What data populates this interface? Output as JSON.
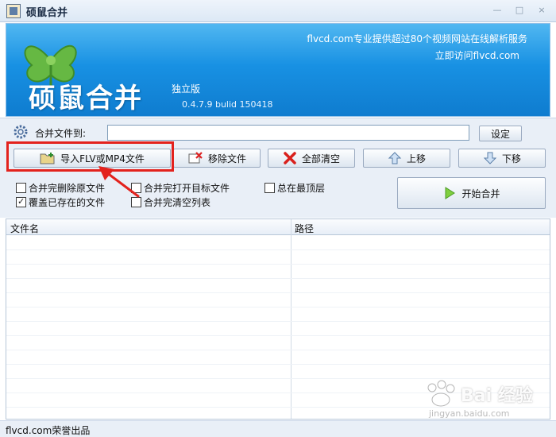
{
  "window": {
    "title": "硕鼠合并",
    "minimize": "—",
    "maximize": "□",
    "close": "×"
  },
  "banner": {
    "info_line1": "flvcd.com专业提供超过80个视频网站在线解析服务",
    "info_line2": "立即访问flvcd.com",
    "brand": "硕鼠合并",
    "edition": "独立版",
    "version": "0.4.7.9  bulid 150418"
  },
  "merge_to": {
    "label": "合并文件到:",
    "value": "",
    "set_label": "设定"
  },
  "toolbar": {
    "import_label": "导入FLV或MP4文件",
    "remove_label": "移除文件",
    "clear_label": "全部清空",
    "up_label": "上移",
    "down_label": "下移"
  },
  "options": {
    "delete_source": {
      "label": "合并完删除原文件",
      "checked": false
    },
    "open_target": {
      "label": "合并完打开目标文件",
      "checked": false
    },
    "always_on_top": {
      "label": "总在最顶层",
      "checked": false
    },
    "overwrite_existing": {
      "label": "覆盖已存在的文件",
      "checked": true
    },
    "clear_list": {
      "label": "合并完清空列表",
      "checked": false
    }
  },
  "start_label": "开始合并",
  "table": {
    "columns": [
      "文件名",
      "路径"
    ],
    "rows": []
  },
  "status": {
    "text": "flvcd.com荣誉出品"
  },
  "watermark": {
    "text": "Bai 经验",
    "sub": "jingyan.baidu.com"
  },
  "colors": {
    "banner_blue": "#1891e3",
    "highlight_red": "#e3221d",
    "panel_bg": "#e9eff7"
  },
  "icons": {
    "app": "app-icon",
    "import": "folder-add-icon",
    "remove": "file-remove-icon",
    "clear": "red-x-icon",
    "up": "arrow-up-icon",
    "down": "arrow-down-icon",
    "start": "play-icon",
    "gear": "gear-icon"
  }
}
